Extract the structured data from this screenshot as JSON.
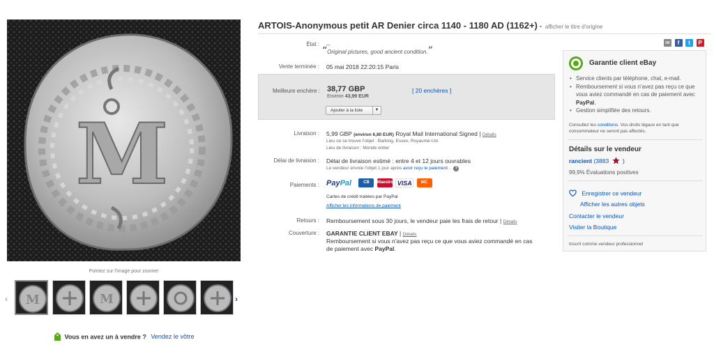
{
  "title": {
    "text": "ARTOIS-Anonymous petit AR Denier circa 1140 - 1180 AD (1162+)",
    "separator": "-",
    "original_link": "afficher le titre d'origine"
  },
  "gallery": {
    "zoom_hint": "Pointez sur l'image pour zoomer",
    "prev_icon": "chevron-left-icon",
    "next_icon": "chevron-right-icon",
    "thumbnail_count": 6
  },
  "sell_bar": {
    "question": "Vous en avez un à vendre ?",
    "link": "Vendez le vôtre"
  },
  "details": {
    "condition_label": "État :",
    "condition_value": "--",
    "condition_quote": "Original pictures, good ancient condition.",
    "ended_label": "Vente terminée :",
    "ended_value": "05 mai 2018  22:20:15 Paris",
    "best_bid_label": "Meilleure enchère :",
    "price": "38,77 GBP",
    "approx_prefix": "Environ",
    "approx_value": "43,99 EUR",
    "bid_count": "[ 20 enchères ]",
    "watch_button": "Ajouter à la liste",
    "shipping_label": "Livraison :",
    "shipping_price": "5,99 GBP",
    "shipping_approx": "(environ 6,80 EUR)",
    "shipping_service": "Royal Mail International Signed",
    "shipping_details_link": "Détails",
    "item_location": "Lieu où se trouve l'objet : Barking, Essex, Royaume-Uni",
    "ships_to": "Lieu de livraison : Monde entier",
    "delivery_label": "Délai de livraison :",
    "delivery_value": "Délai de livraison estimé : entre 4 et 12 jours ouvrables",
    "delivery_note": "Le vendeur envoie l'objet 1 jour après",
    "delivery_note_link": "avoir reçu le paiement .",
    "payments_label": "Paiements :",
    "paypal_cards": "Cartes de crédit traitées par PayPal",
    "payment_info_link": "Afficher les informations de paiement",
    "returns_label": "Retours :",
    "returns_value": "Remboursement sous 30 jours, le vendeur paie les frais de retour",
    "returns_details_link": "Détails",
    "coverage_label": "Couverture :",
    "coverage_title": "GARANTIE CLIENT EBAY",
    "coverage_details_link": "Détails",
    "coverage_text_1": "Remboursement si vous n'avez pas reçu ce que vous aviez commandé en cas",
    "coverage_text_2_prefix": "de paiement avec",
    "coverage_text_2_bold": "PayPal",
    "coverage_text_2_suffix": "."
  },
  "payment_logos": {
    "paypal": [
      "Pay",
      "Pal"
    ],
    "cb": "CB",
    "maestro": "Maestro",
    "visa": "VISA",
    "mastercard": "MC"
  },
  "share": {
    "icons": [
      "email-icon",
      "facebook-icon",
      "twitter-icon",
      "pinterest-icon"
    ],
    "facebook": "f",
    "twitter": "t",
    "pinterest": "P"
  },
  "guarantee": {
    "title": "Garantie client eBay",
    "items": [
      "Service clients par téléphone, chat, e-mail.",
      "Remboursement si vous n'avez pas reçu ce que vous aviez commandé en cas de paiement avec",
      "Gestion simplifiée des retours."
    ],
    "paypal_bold": "PayPal",
    "item2_suffix": ".",
    "note_prefix": "Consultez les",
    "note_link": "conditions",
    "note_suffix": ". Vos droits légaux en tant que consommateur ne seront pas affectés."
  },
  "seller": {
    "heading": "Détails sur le vendeur",
    "name": "rancient",
    "score_open": "(3883",
    "score_close": ")",
    "feedback": "99,9% Évaluations positives",
    "save": "Enregistrer ce vendeur",
    "other_items": "Afficher les autres objets",
    "contact": "Contacter le vendeur",
    "store": "Visiter la Boutique",
    "pro": "Inscrit comme vendeur professionnel"
  },
  "colors": {
    "link": "#0654ba",
    "star": "#d0021b",
    "guarantee_green": "#5ba71b",
    "paypal_dark": "#253b80",
    "paypal_light": "#179bd7"
  }
}
